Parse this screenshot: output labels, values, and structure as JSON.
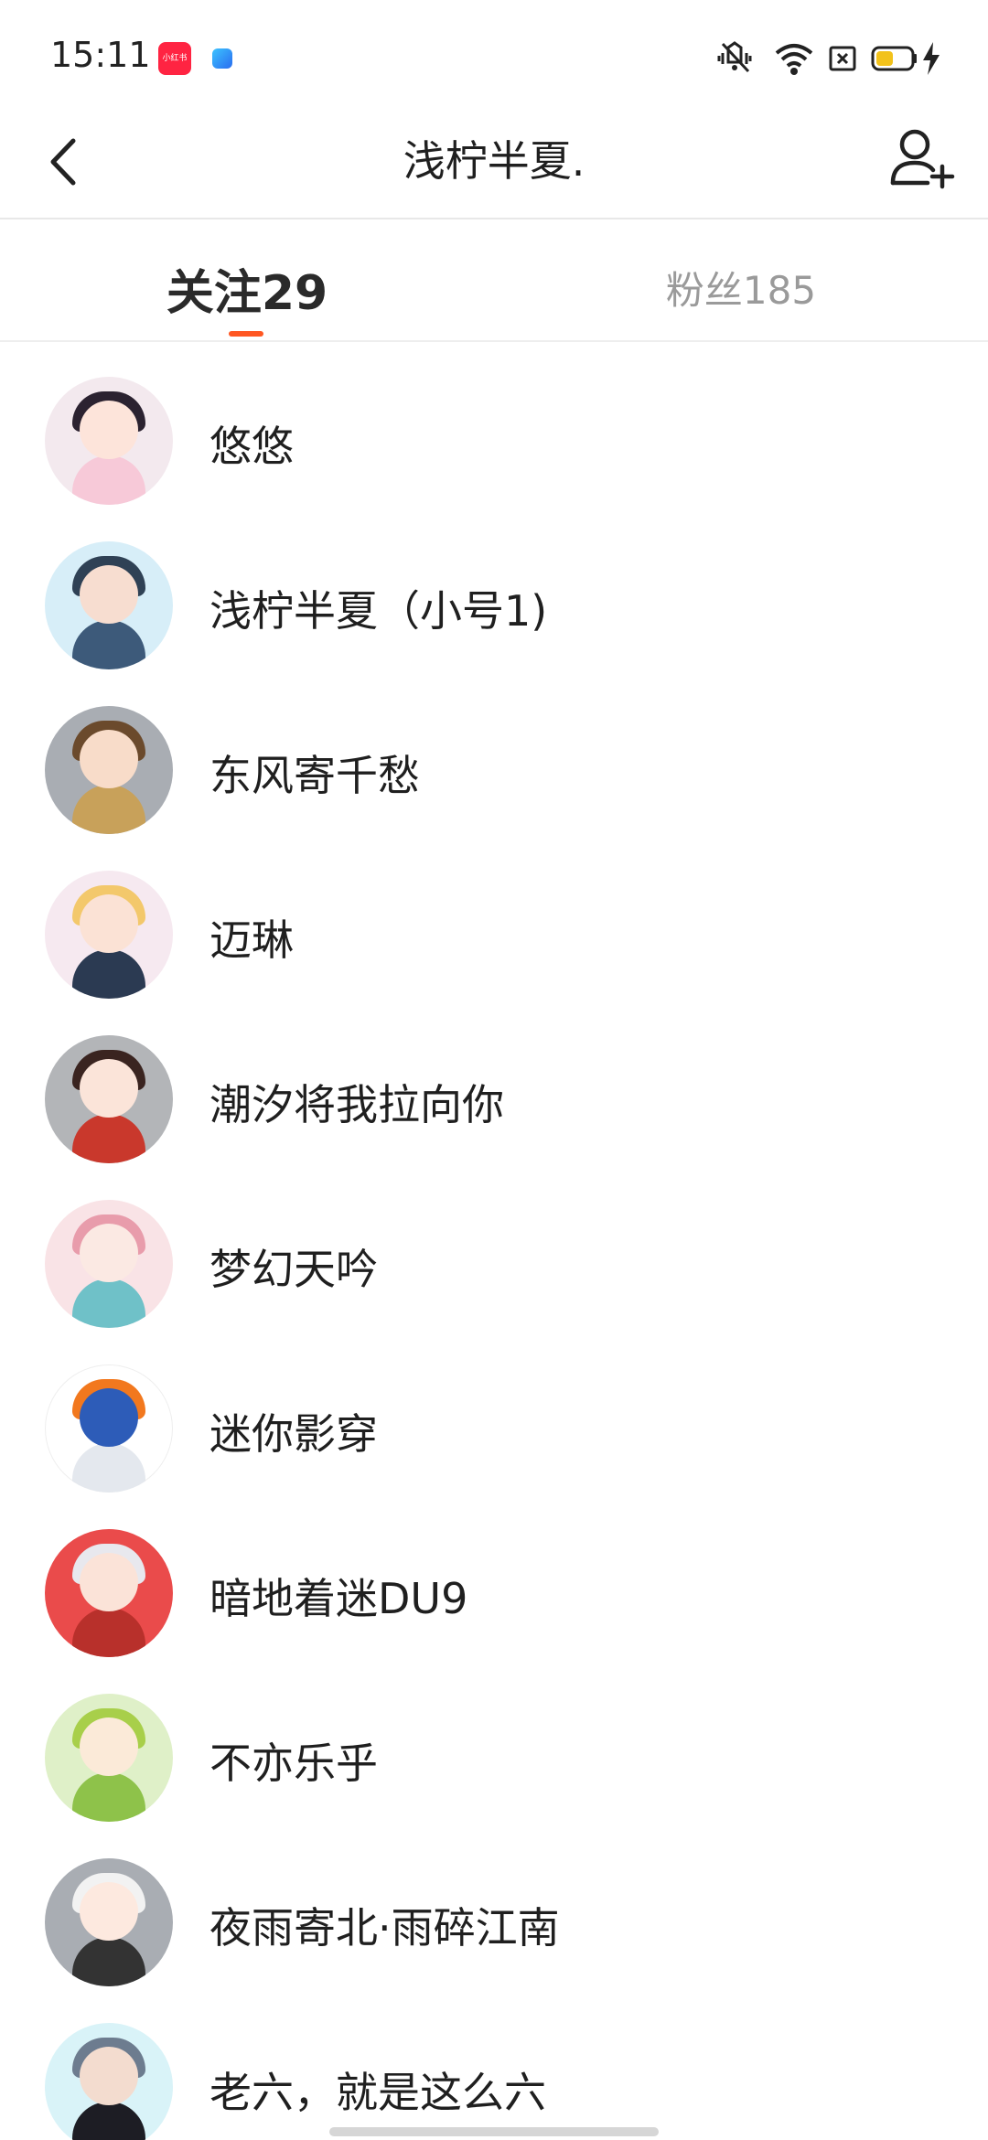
{
  "status_bar": {
    "time": "15:11",
    "red_app_label": "小红书"
  },
  "header": {
    "title": "浅柠半夏."
  },
  "tabs": {
    "following": "关注29",
    "fans": "粉丝185"
  },
  "users": [
    {
      "name": "悠悠",
      "avatar_bg": "#f3e9ee",
      "hair": "#2b2230",
      "face": "#fde4da",
      "body": "#f7c9d8"
    },
    {
      "name": "浅柠半夏（小号1)",
      "avatar_bg": "#d7eef8",
      "hair": "#2f4155",
      "face": "#f7ddd0",
      "body": "#3d5a7a"
    },
    {
      "name": "东风寄千愁",
      "avatar_bg": "#a9adb3",
      "hair": "#6b4a2c",
      "face": "#f8dcc9",
      "body": "#c8a15a"
    },
    {
      "name": "迈琳",
      "avatar_bg": "#f6e9f0",
      "hair": "#f3c86b",
      "face": "#fbe2d5",
      "body": "#2b3a52"
    },
    {
      "name": "潮汐将我拉向你",
      "avatar_bg": "#b3b5b8",
      "hair": "#3a2420",
      "face": "#fbe4d9",
      "body": "#c9382c"
    },
    {
      "name": "梦幻天吟",
      "avatar_bg": "#f9e3e6",
      "hair": "#e89cab",
      "face": "#fbe9e3",
      "body": "#6fc1c8"
    },
    {
      "name": "迷你影穿",
      "avatar_bg": "#ffffff",
      "hair": "#f2781e",
      "face": "#2d5cb8",
      "body": "#e4e8ee"
    },
    {
      "name": "暗地着迷DU9",
      "avatar_bg": "#ea4b4b",
      "hair": "#e8e8ee",
      "face": "#fbe3d8",
      "body": "#b8302b"
    },
    {
      "name": "不亦乐乎",
      "avatar_bg": "#dff0c8",
      "hair": "#a8cf4a",
      "face": "#fbead8",
      "body": "#8ec24a"
    },
    {
      "name": "夜雨寄北·雨碎江南",
      "avatar_bg": "#a9adb3",
      "hair": "#f2f2f2",
      "face": "#fde9df",
      "body": "#333333"
    },
    {
      "name": "老六，就是这么六",
      "avatar_bg": "#d9f3f8",
      "hair": "#6d7c8f",
      "face": "#f3dccf",
      "body": "#1d1d24"
    }
  ],
  "colors": {
    "accent": "#ff5722",
    "muted_text": "#9a9a9a",
    "divider": "#e8e8e8"
  }
}
